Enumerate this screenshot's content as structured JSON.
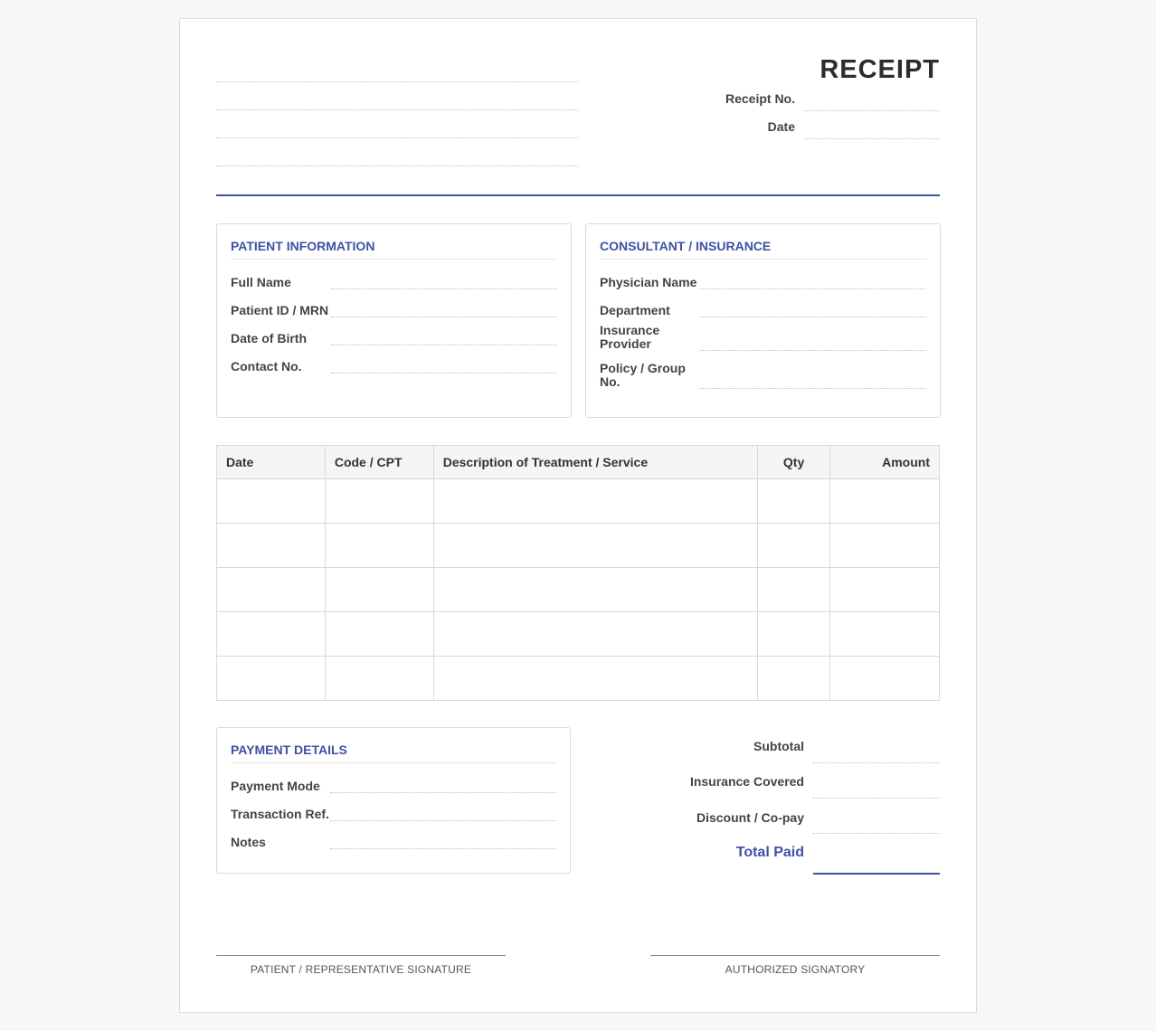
{
  "header": {
    "title": "RECEIPT",
    "receipt_no_label": "Receipt No.",
    "date_label": "Date"
  },
  "patient_info": {
    "title": "PATIENT INFORMATION",
    "fields": [
      "Full Name",
      "Patient ID / MRN",
      "Date of Birth",
      "Contact No."
    ]
  },
  "consultant": {
    "title": "CONSULTANT / INSURANCE",
    "fields": [
      "Physician Name",
      "Department",
      "Insurance Provider",
      "Policy / Group No."
    ]
  },
  "items_table": {
    "columns": [
      "Date",
      "Code / CPT",
      "Description of Treatment / Service",
      "Qty",
      "Amount"
    ]
  },
  "payment": {
    "title": "PAYMENT DETAILS",
    "fields": [
      "Payment Mode",
      "Transaction Ref.",
      "Notes"
    ]
  },
  "totals": {
    "subtotal": "Subtotal",
    "insurance_covered": "Insurance Covered",
    "discount": "Discount / Co-pay",
    "total_paid": "Total Paid"
  },
  "signatures": {
    "patient": "PATIENT / REPRESENTATIVE SIGNATURE",
    "authorized": "AUTHORIZED SIGNATORY"
  },
  "colors": {
    "accent": "#3f51a3"
  }
}
